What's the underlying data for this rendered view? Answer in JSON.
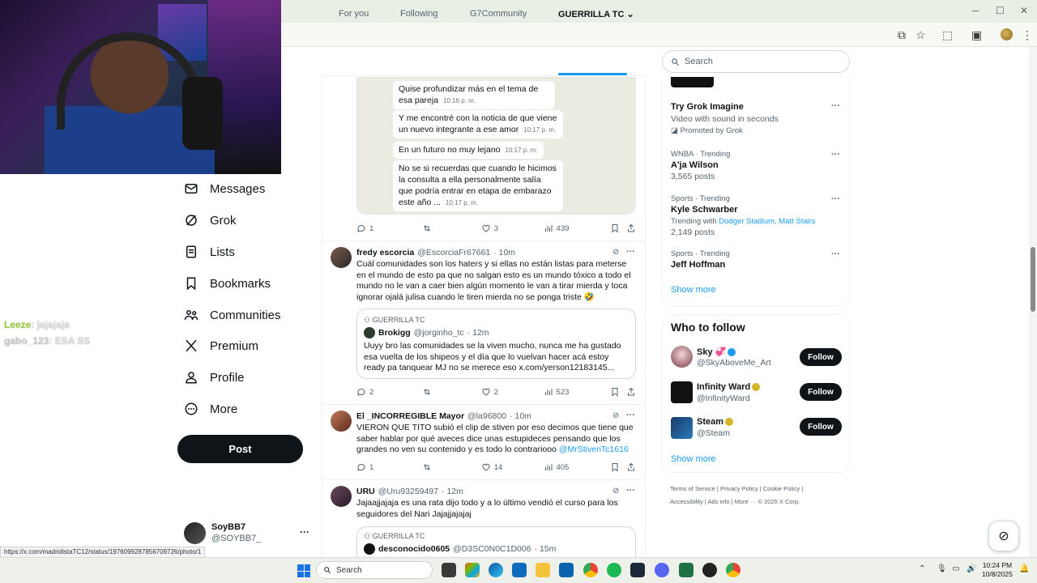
{
  "browser": {
    "window_min": "─",
    "window_max": "☐",
    "window_close": "✕"
  },
  "chat_overlay": [
    {
      "user": "Leeze",
      "message": ": jajajaja"
    },
    {
      "user": "gabo_123",
      "message": ": ESA SS"
    }
  ],
  "nav": {
    "items": [
      {
        "label": "Messages",
        "icon": "mail-icon"
      },
      {
        "label": "Grok",
        "icon": "grok-icon"
      },
      {
        "label": "Lists",
        "icon": "lists-icon"
      },
      {
        "label": "Bookmarks",
        "icon": "bookmark-icon"
      },
      {
        "label": "Communities",
        "icon": "communities-icon"
      },
      {
        "label": "Premium",
        "icon": "x-icon"
      },
      {
        "label": "Profile",
        "icon": "person-icon"
      },
      {
        "label": "More",
        "icon": "more-circle-icon"
      }
    ],
    "post_label": "Post",
    "account": {
      "name": "SoyBB7",
      "handle": "@SOYBB7_",
      "more": "···"
    }
  },
  "tabs": [
    "For you",
    "Following",
    "G7Community",
    "GUERRILLA TC"
  ],
  "chat_image": {
    "bubbles": [
      {
        "text": "Quise profundizar más en el tema de esa pareja",
        "time": "10:16 p. m."
      },
      {
        "text": "Y me encontré con la noticia de que viene un nuevo integrante a ese amor",
        "time": "10:17 p. m."
      },
      {
        "text": "En un futuro no muy lejano",
        "time": "10:17 p. m."
      },
      {
        "text": "No se si recuerdas que cuando le hicimos la consulta a ella personalmente salía que podría entrar en etapa de embarazo este año ...",
        "time": "10:17 p. m."
      }
    ]
  },
  "posts": [
    {
      "actions": {
        "replies": "1",
        "reposts": "",
        "likes": "3",
        "views": "439"
      }
    },
    {
      "name": "fredy escorcia",
      "handle": "@EscorciaFr67661",
      "time": "· 10m",
      "text": "Cuál comunidades son los haters y si ellas no están listas para meterse en el mundo de esto pa que no salgan esto es un mundo tóxico a todo el mundo no le van a caer bien algún momento le van a tirar mierda y toca ignorar ojalá julisa cuando le tiren mierda no se ponga triste 🤣",
      "quote": {
        "community": "GUERRILLA TC",
        "name": "Brokigg",
        "handle": "@jorginho_tc",
        "time": "· 12m",
        "text": "Uuyy bro las comunidades se la viven mucho, nunca me ha gustado esa vuelta de los shipeos y el día que lo vuelvan hacer acá estoy ready pa tanquear MJ no se merece eso x.com/yerson12183145..."
      },
      "actions": {
        "replies": "2",
        "reposts": "",
        "likes": "2",
        "views": "523"
      }
    },
    {
      "name": "El _INCORREGIBLE Mayor",
      "handle": "@la96800",
      "time": "· 10m",
      "text": "VIERON QUE TITO subió el clip de stiven por eso decimos que tiene que saber hablar por qué aveces dice unas estupideces pensando que los grandes no ven su contenido y es todo lo contrariooo",
      "mention": "@MrStivenTc1616",
      "actions": {
        "replies": "1",
        "reposts": "",
        "likes": "14",
        "views": "405"
      }
    },
    {
      "name": "URU",
      "handle": "@Uru93259497",
      "time": "· 12m",
      "text": "Jajaajjajaja es una rata dijo todo y a lo último vendió el curso para los seguidores del Nari Jajajjajajaj",
      "quote": {
        "community": "GUERRILLA TC",
        "name": "desconocido0605",
        "handle": "@D3SC0N0C1D006",
        "time": "· 15m"
      }
    }
  ],
  "search": {
    "placeholder": "Search"
  },
  "trends": [
    {
      "meta": "",
      "title": "Try Grok Imagine",
      "sub": "Video with sound in seconds",
      "promo": "Promoted by Grok"
    },
    {
      "meta": "WNBA · Trending",
      "title": "A'ja Wilson",
      "sub": "3,565 posts"
    },
    {
      "meta": "Sports · Trending",
      "title": "Kyle Schwarber",
      "sub_prefix": "Trending with",
      "sub_links": "Dodger Stadium, Matt Stairs",
      "sub": "2,149 posts"
    },
    {
      "meta": "Sports · Trending",
      "title": "Jeff Hoffman"
    }
  ],
  "show_more": "Show more",
  "who_to_follow": {
    "title": "Who to follow",
    "accounts": [
      {
        "name": "Sky",
        "handle": "@SkyAboveMe_Art",
        "button": "Follow"
      },
      {
        "name": "Infinity Ward",
        "handle": "@InfinityWard",
        "button": "Follow"
      },
      {
        "name": "Steam",
        "handle": "@Steam",
        "button": "Follow"
      }
    ],
    "show_more": "Show more"
  },
  "footer": {
    "line1": "Terms of Service  |  Privacy Policy  |  Cookie Policy  |",
    "line2": "Accessibility  |  Ads info  |  More ···   © 2025 X Corp."
  },
  "status_url": "https://x.com/madridistaTC12/status/1976099287856709726/photo/1",
  "taskbar": {
    "search": "Search",
    "time": "10:24 PM",
    "date": "10/8/2025"
  },
  "colors": {
    "accent": "#1d9bf0",
    "text": "#0f1419",
    "muted": "#536471"
  }
}
